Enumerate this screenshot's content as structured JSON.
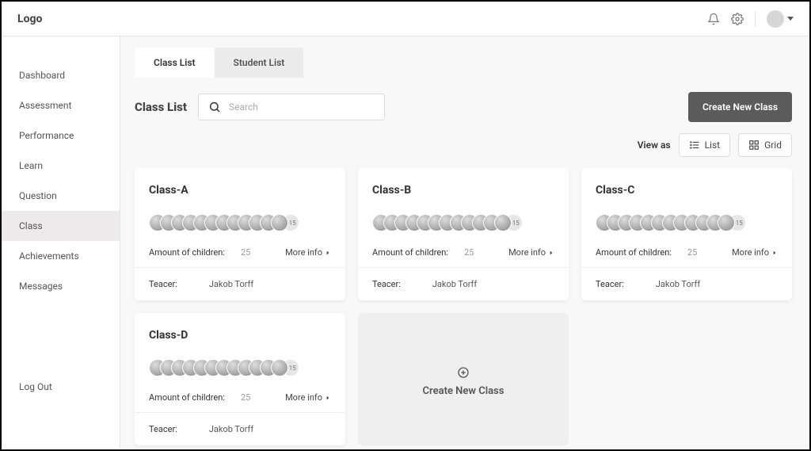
{
  "logo": "Logo",
  "sidebar": {
    "items": [
      {
        "label": "Dashboard"
      },
      {
        "label": "Assessment"
      },
      {
        "label": "Performance"
      },
      {
        "label": "Learn"
      },
      {
        "label": "Question"
      },
      {
        "label": "Class",
        "active": true
      },
      {
        "label": "Achievements"
      },
      {
        "label": "Messages"
      }
    ],
    "logout_label": "Log Out"
  },
  "tabs": [
    {
      "label": "Class List",
      "active": true
    },
    {
      "label": "Student List"
    }
  ],
  "page_title": "Class List",
  "search": {
    "placeholder": "Search"
  },
  "create_button_label": "Create New Class",
  "view": {
    "label": "View as",
    "list_label": "List",
    "grid_label": "Grid"
  },
  "card_labels": {
    "children": "Amount of children:",
    "more": "More info",
    "teacher": "Teacer:",
    "more_count": "+15"
  },
  "classes": [
    {
      "name": "Class-A",
      "children": "25",
      "teacher": "Jakob Torff"
    },
    {
      "name": "Class-B",
      "children": "25",
      "teacher": "Jakob Torff"
    },
    {
      "name": "Class-C",
      "children": "25",
      "teacher": "Jakob Torff"
    },
    {
      "name": "Class-D",
      "children": "25",
      "teacher": "Jakob Torff"
    }
  ],
  "create_card_label": "Create New Class"
}
